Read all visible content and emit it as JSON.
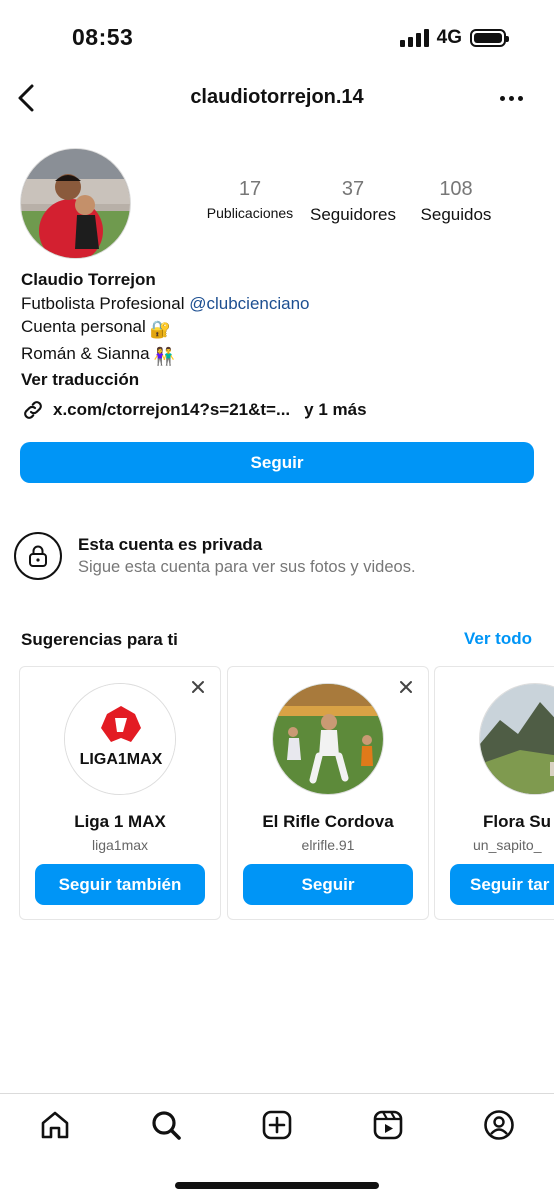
{
  "status_bar": {
    "time": "08:53",
    "network": "4G"
  },
  "header": {
    "username": "claudiotorrejon.14",
    "back_icon": "chevron-left-icon",
    "more_icon": "ellipsis-icon"
  },
  "profile": {
    "stats": {
      "posts_count": "17",
      "posts_label": "Publicaciones",
      "followers_count": "37",
      "followers_label": "Seguidores",
      "following_count": "108",
      "following_label": "Seguidos"
    },
    "bio": {
      "name": "Claudio Torrejon",
      "line1_text": "Futbolista Profesional",
      "line1_mention": "@clubcienciano",
      "line2": "Cuenta personal",
      "line2_emoji": "🔐",
      "line3": "Román & Sianna",
      "line3_emoji": "👫",
      "translation": "Ver traducción"
    },
    "link": {
      "url": "x.com/ctorrejon14?s=21&t=...",
      "more": "y 1 más"
    },
    "follow_button": "Seguir"
  },
  "private_notice": {
    "title": "Esta cuenta es privada",
    "subtitle": "Sigue esta cuenta para ver sus fotos y videos."
  },
  "suggestions": {
    "title": "Sugerencias para ti",
    "see_all": "Ver todo",
    "cards": [
      {
        "name": "Liga 1 MAX",
        "handle": "liga1max",
        "button": "Seguir también",
        "logo_text": "LIGA1MAX"
      },
      {
        "name": "El Rifle Cordova",
        "handle": "elrifle.91",
        "button": "Seguir"
      },
      {
        "name": "Flora Su",
        "handle": "un_sapito_",
        "button": "Seguir tar"
      }
    ]
  },
  "tab_bar": {
    "items": [
      "home-icon",
      "search-icon",
      "create-icon",
      "reels-icon",
      "profile-icon"
    ]
  },
  "colors": {
    "accent": "#0095f6",
    "mention": "#1d4f91",
    "secondary_text": "#777777"
  }
}
